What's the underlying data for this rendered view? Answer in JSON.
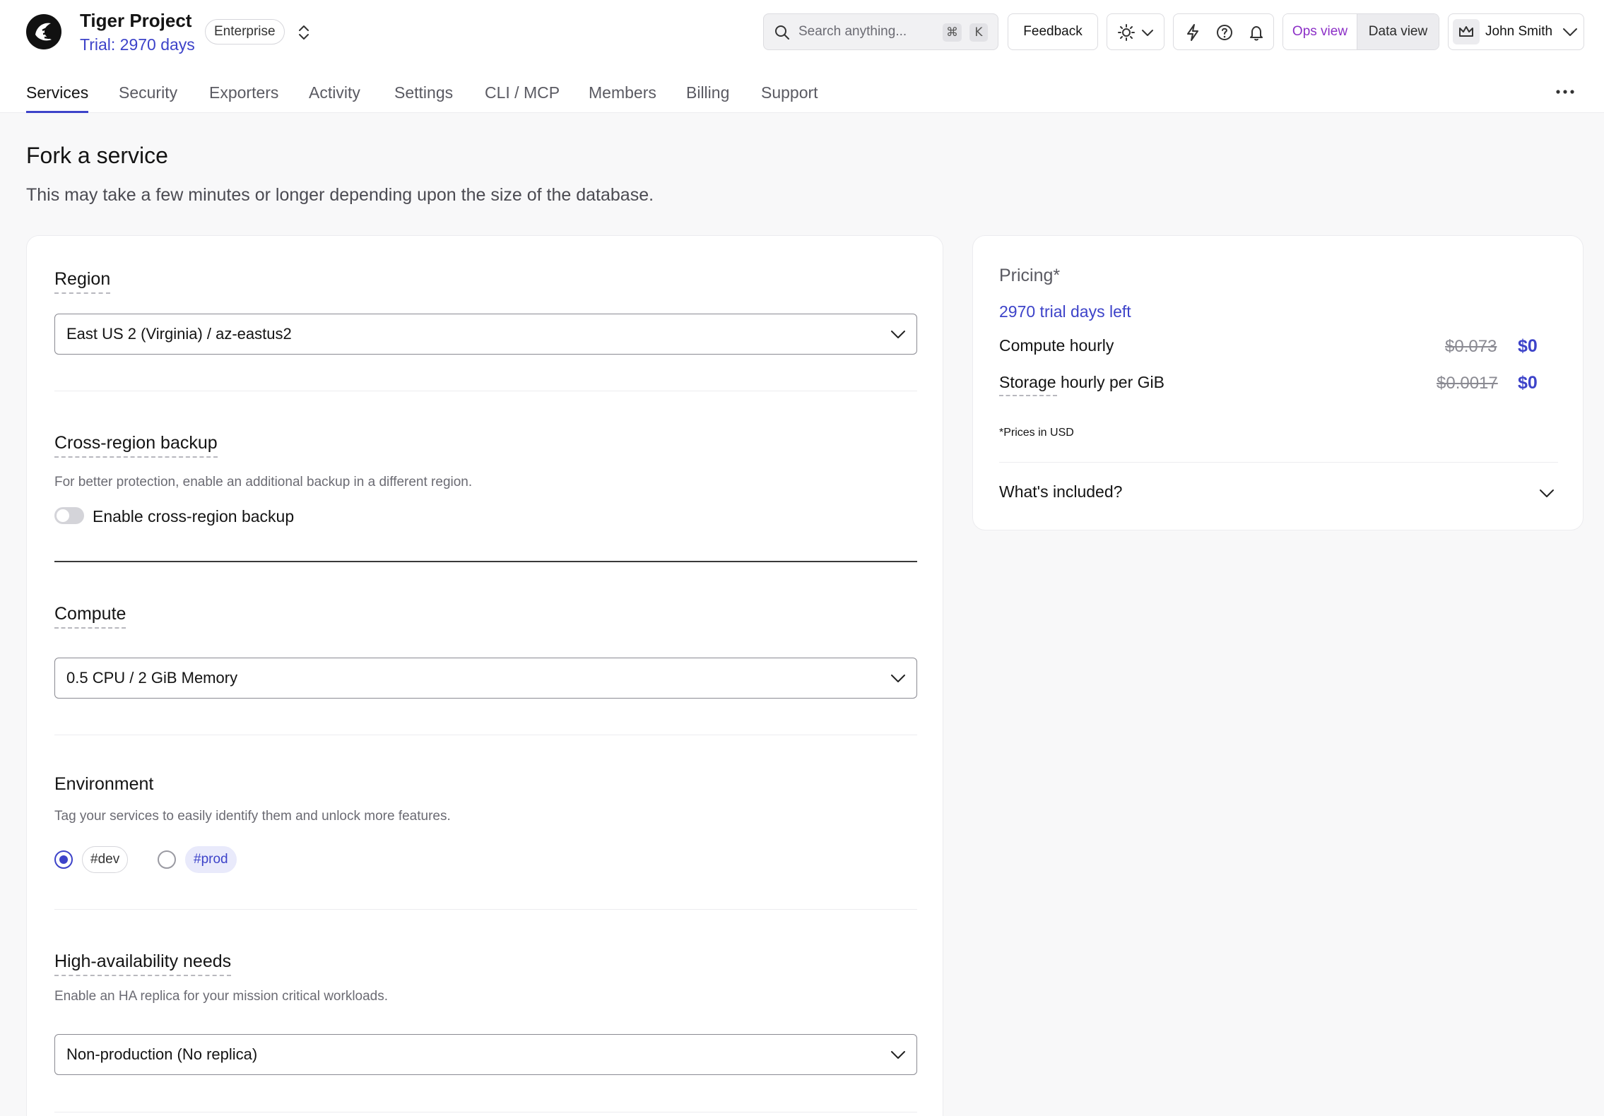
{
  "header": {
    "project_name": "Tiger Project",
    "trial_text": "Trial: 2970 days",
    "plan_badge": "Enterprise",
    "search_placeholder": "Search anything...",
    "search_shortcut_cmd": "⌘",
    "search_shortcut_key": "K",
    "feedback_label": "Feedback",
    "ops_view_label": "Ops view",
    "data_view_label": "Data view",
    "user_name": "John Smith",
    "accent_color": "#3d43c9",
    "ops_view_color": "#8c2fc7"
  },
  "tabs": [
    {
      "label": "Services",
      "active": true
    },
    {
      "label": "Security"
    },
    {
      "label": "Exporters"
    },
    {
      "label": "Activity"
    },
    {
      "label": "Settings"
    },
    {
      "label": "CLI / MCP"
    },
    {
      "label": "Members"
    },
    {
      "label": "Billing"
    },
    {
      "label": "Support"
    }
  ],
  "page": {
    "title": "Fork a service",
    "subtitle": "This may take a few minutes or longer depending upon the size of the database."
  },
  "form": {
    "region": {
      "title": "Region",
      "selected": "East US 2 (Virginia) / az-eastus2"
    },
    "backup": {
      "title": "Cross-region backup",
      "description": "For better protection, enable an additional backup in a different region.",
      "toggle_label": "Enable cross-region backup",
      "enabled": false
    },
    "compute": {
      "title": "Compute",
      "selected": "0.5 CPU / 2 GiB Memory"
    },
    "environment": {
      "title": "Environment",
      "description": "Tag your services to easily identify them and unlock more features.",
      "options": [
        {
          "tag": "#dev",
          "selected": true
        },
        {
          "tag": "#prod",
          "selected": false
        }
      ]
    },
    "ha": {
      "title": "High-availability needs",
      "description": "Enable an HA replica for your mission critical workloads.",
      "selected": "Non-production (No replica)"
    }
  },
  "pricing": {
    "title": "Pricing*",
    "trial_left": "2970 trial days left",
    "rows": [
      {
        "label": "Compute hourly",
        "old_price": "$0.073",
        "new_price": "$0"
      },
      {
        "label": "Storage hourly per GiB",
        "old_price": "$0.0017",
        "new_price": "$0"
      }
    ],
    "note": "*Prices in USD",
    "included_label": "What's included?"
  }
}
